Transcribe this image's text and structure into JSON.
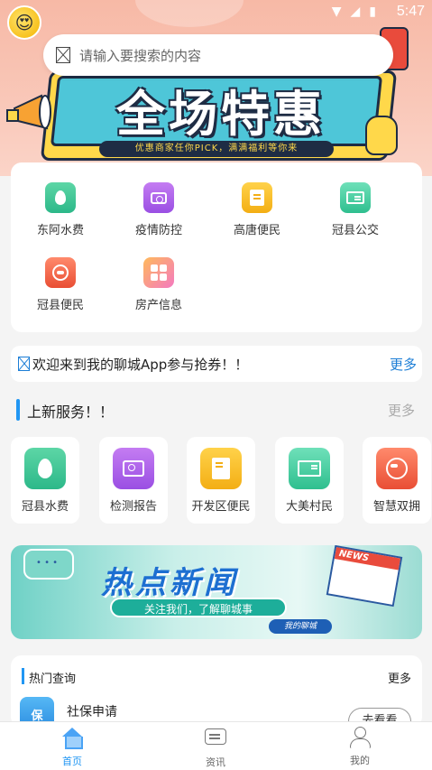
{
  "status": {
    "time": "5:47"
  },
  "search": {
    "placeholder": "请输入要搜索的内容"
  },
  "banner": {
    "title": "全场特惠",
    "subtitle": "优惠商家任你PICK，满满福利等你来"
  },
  "grid": {
    "items": [
      {
        "label": "东阿水费",
        "icon": "water-drop-icon"
      },
      {
        "label": "疫情防控",
        "icon": "camera-icon"
      },
      {
        "label": "高唐便民",
        "icon": "bookmark-icon"
      },
      {
        "label": "冠县公交",
        "icon": "card-icon"
      },
      {
        "label": "冠县便民",
        "icon": "phone-icon"
      },
      {
        "label": "房产信息",
        "icon": "apps-icon"
      }
    ]
  },
  "notice": {
    "text": "欢迎来到我的聊城App参与抢券！！",
    "more": "更多"
  },
  "new_services": {
    "title": "上新服务！！",
    "more": "更多",
    "items": [
      {
        "label": "冠县水费",
        "icon": "water-drop-icon"
      },
      {
        "label": "检测报告",
        "icon": "camera-icon"
      },
      {
        "label": "开发区便民",
        "icon": "bookmark-icon"
      },
      {
        "label": "大美村民",
        "icon": "card-icon"
      },
      {
        "label": "智慧双拥",
        "icon": "phone-icon"
      }
    ]
  },
  "news_banner": {
    "title": "热点新闻",
    "subtitle": "关注我们，了解聊城事",
    "tag": "我的聊城",
    "paper_label": "NEWS"
  },
  "hot": {
    "title": "热门查询",
    "more": "更多",
    "item": {
      "label": "社保申请",
      "icon_text": "保",
      "button": "去看看"
    }
  },
  "tabs": [
    {
      "label": "首页",
      "icon": "home-icon",
      "active": true
    },
    {
      "label": "资讯",
      "icon": "chat-icon",
      "active": false
    },
    {
      "label": "我的",
      "icon": "user-icon",
      "active": false
    }
  ],
  "colors": {
    "accent": "#2196f3",
    "banner_bg": "#f9c8b9"
  }
}
